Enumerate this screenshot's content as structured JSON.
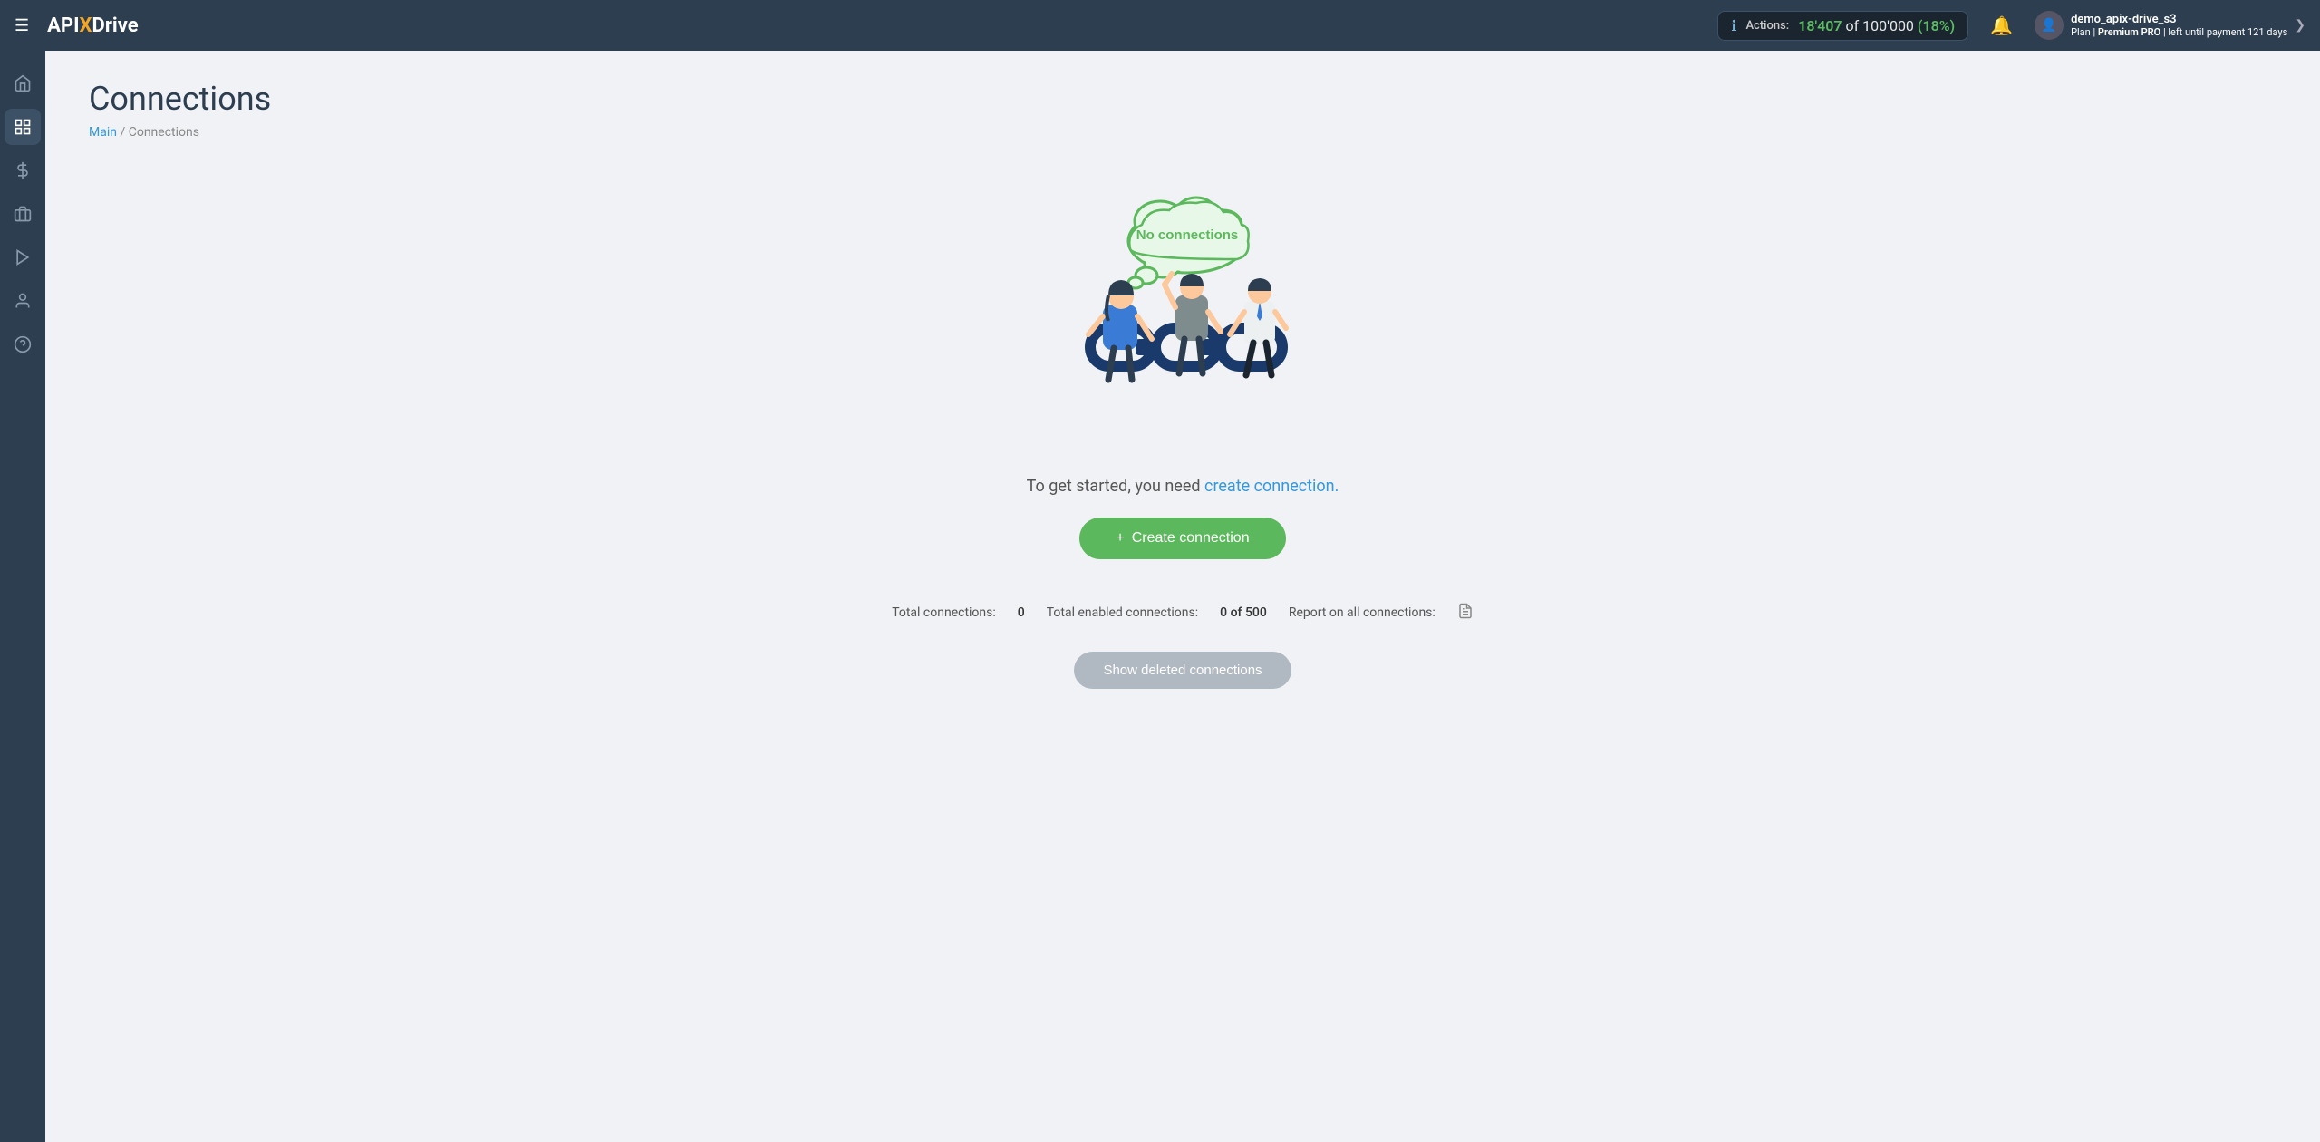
{
  "header": {
    "menu_icon": "☰",
    "logo": {
      "api": "API",
      "x": "X",
      "drive": "Drive"
    },
    "actions": {
      "label": "Actions:",
      "used": "18'407",
      "of_text": "of",
      "total": "100'000",
      "pct": "(18%)"
    },
    "user": {
      "name": "demo_apix-drive_s3",
      "plan_label": "Plan |",
      "plan": "Premium PRO",
      "left_text": "| left until payment",
      "days": "121 days"
    },
    "chevron": "❯"
  },
  "sidebar": {
    "items": [
      {
        "id": "home",
        "icon": "⌂",
        "label": "Home"
      },
      {
        "id": "connections",
        "icon": "⊞",
        "label": "Connections"
      },
      {
        "id": "billing",
        "icon": "$",
        "label": "Billing"
      },
      {
        "id": "integrations",
        "icon": "⊡",
        "label": "Integrations"
      },
      {
        "id": "media",
        "icon": "▶",
        "label": "Media"
      },
      {
        "id": "profile",
        "icon": "◯",
        "label": "Profile"
      },
      {
        "id": "help",
        "icon": "?",
        "label": "Help"
      }
    ]
  },
  "page": {
    "title": "Connections",
    "breadcrumb_main": "Main",
    "breadcrumb_sep": " / ",
    "breadcrumb_current": "Connections"
  },
  "content": {
    "no_connections_label": "No connections",
    "cta_static": "To get started, you need ",
    "cta_link": "create connection.",
    "create_btn_plus": "+",
    "create_btn_label": "Create connection",
    "total_connections_label": "Total connections:",
    "total_connections_value": "0",
    "total_enabled_label": "Total enabled connections:",
    "total_enabled_value": "0 of 500",
    "report_label": "Report on all connections:",
    "show_deleted_label": "Show deleted connections"
  }
}
